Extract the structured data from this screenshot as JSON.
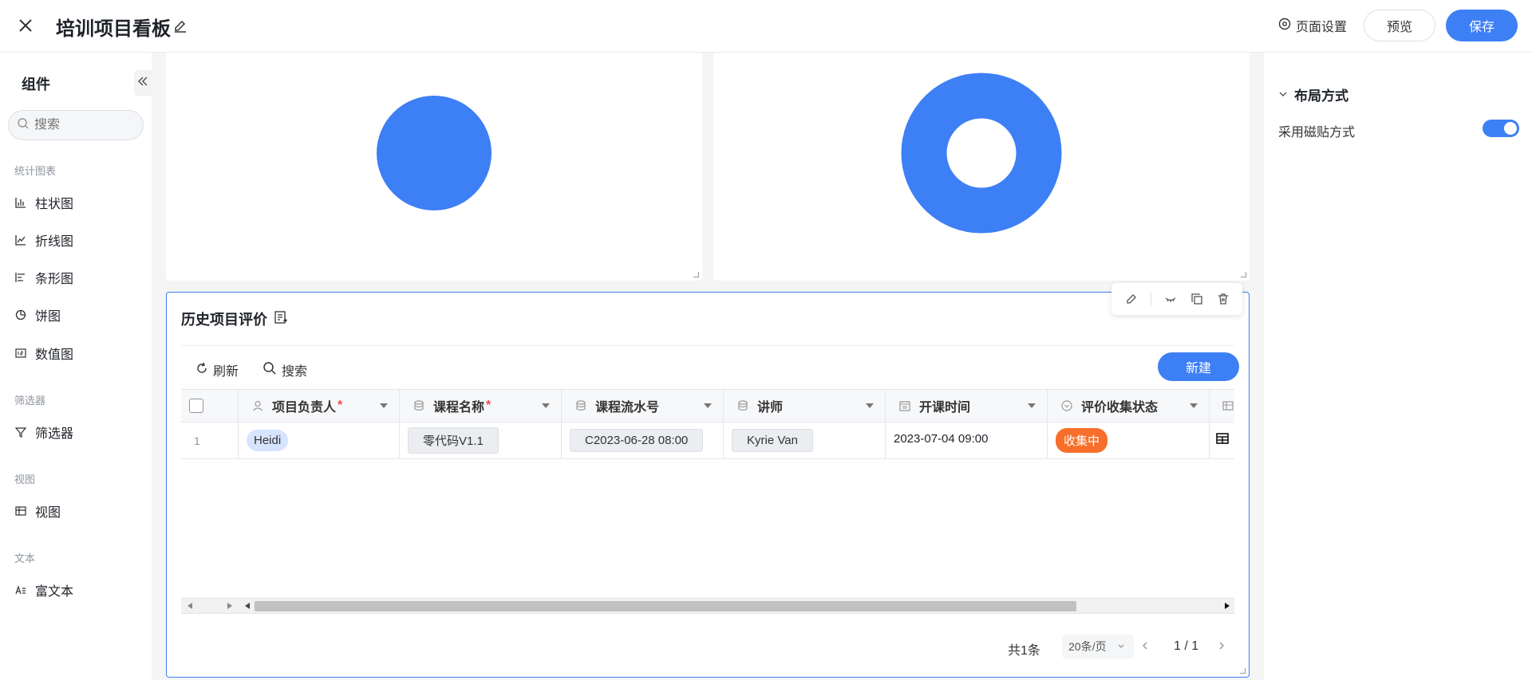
{
  "header": {
    "title": "培训项目看板",
    "page_settings": "页面设置",
    "preview": "预览",
    "save": "保存"
  },
  "sidebar": {
    "title": "组件",
    "search_placeholder": "搜索",
    "sections": [
      {
        "label": "统计图表",
        "items": [
          "柱状图",
          "折线图",
          "条形图",
          "饼图",
          "数值图"
        ]
      },
      {
        "label": "筛选器",
        "items": [
          "筛选器"
        ]
      },
      {
        "label": "视图",
        "items": [
          "视图"
        ]
      },
      {
        "label": "文本",
        "items": [
          "富文本"
        ]
      }
    ]
  },
  "right_panel": {
    "layout_section": "布局方式",
    "tile_mode_label": "采用磁贴方式",
    "tile_mode_on": true
  },
  "charts": {
    "accent": "#3d7ff5"
  },
  "table_card": {
    "title": "历史项目评价",
    "refresh": "刷新",
    "search": "搜索",
    "new_button": "新建",
    "columns": [
      "项目负责人",
      "课程名称",
      "课程流水号",
      "讲师",
      "开课时间",
      "评价收集状态"
    ],
    "rows": [
      {
        "index": "1",
        "owner": "Heidi",
        "course": "零代码V1.1",
        "serial": "C2023-06-28 08:00",
        "lecturer": "Kyrie Van",
        "start_time": "2023-07-04 09:00",
        "status": "收集中"
      }
    ],
    "footer": {
      "total": "共1条",
      "page_size": "20条/页",
      "page": "1 / 1"
    }
  }
}
